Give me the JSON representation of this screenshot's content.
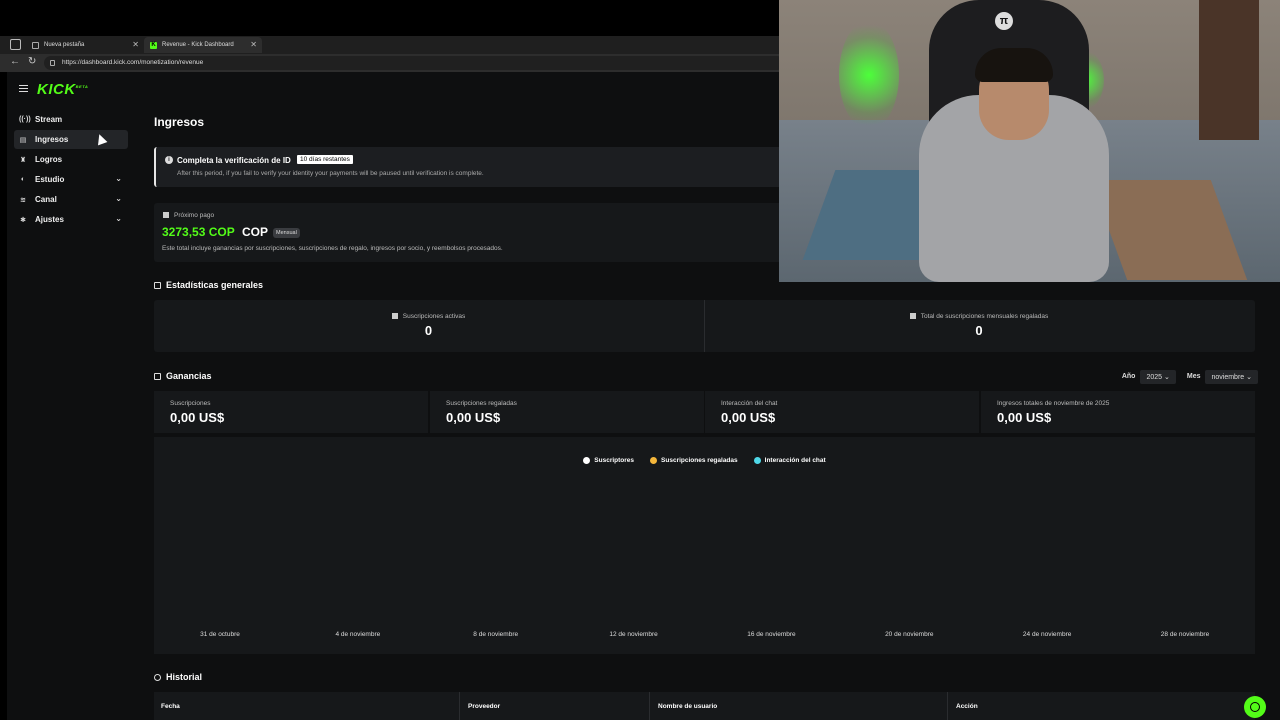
{
  "browser": {
    "tabs": [
      {
        "label": "Nueva pestaña"
      },
      {
        "label": "Revenue - Kick Dashboard"
      }
    ],
    "url": "https://dashboard.kick.com/monetization/revenue"
  },
  "sidebar": {
    "logo": "KICK",
    "logo_sup": "BETA",
    "items": [
      {
        "label": "Stream",
        "icon": "broadcast-icon"
      },
      {
        "label": "Ingresos",
        "icon": "revenue-icon"
      },
      {
        "label": "Logros",
        "icon": "trophy-icon"
      },
      {
        "label": "Estudio",
        "icon": "studio-icon"
      },
      {
        "label": "Canal",
        "icon": "channel-icon"
      },
      {
        "label": "Ajustes",
        "icon": "gear-icon"
      }
    ]
  },
  "main": {
    "title": "Ingresos",
    "verification": {
      "title": "Completa la verificación de ID",
      "badge": "10 días restantes",
      "subtitle": "After this period, if you fail to verify your identity your payments will be paused until verification is complete."
    },
    "next_payment": {
      "label": "Próximo pago",
      "amount": "3273,53 COP",
      "currency": "COP",
      "period": "Mensual",
      "description": "Este total incluye ganancias por suscripciones, suscripciones de regalo, ingresos por socio, y reembolsos procesados."
    },
    "stats_title": "Estadísticas generales",
    "stats": [
      {
        "label": "Suscripciones activas",
        "value": "0"
      },
      {
        "label": "Total de suscripciones mensuales regaladas",
        "value": "0"
      }
    ],
    "earnings_title": "Ganancias",
    "filters": {
      "year_label": "Año",
      "year_value": "2025",
      "month_label": "Mes",
      "month_value": "noviembre"
    },
    "earnings": [
      {
        "label": "Suscripciones",
        "value": "0,00 US$"
      },
      {
        "label": "Suscripciones regaladas",
        "value": "0,00 US$"
      },
      {
        "label": "Interacción del chat",
        "value": "0,00 US$"
      },
      {
        "label": "Ingresos totales de noviembre de 2025",
        "value": "0,00 US$"
      }
    ],
    "history_title": "Historial",
    "history_columns": [
      "Fecha",
      "Proveedor",
      "Nombre de usuario",
      "Acción"
    ]
  },
  "chart_data": {
    "type": "line",
    "x": [
      "31 de octubre",
      "4 de noviembre",
      "8 de noviembre",
      "12 de noviembre",
      "16 de noviembre",
      "20 de noviembre",
      "24 de noviembre",
      "28 de noviembre"
    ],
    "series": [
      {
        "name": "Suscriptores",
        "color": "#ffffff",
        "values": []
      },
      {
        "name": "Suscripciones regaladas",
        "color": "#f5b73b",
        "values": []
      },
      {
        "name": "Interacción del chat",
        "color": "#4fd8e8",
        "values": []
      }
    ],
    "legend": "top-center",
    "grid": false
  },
  "colors": {
    "accent": "#53fc18",
    "background": "#0e0f10",
    "card": "#16181a"
  }
}
